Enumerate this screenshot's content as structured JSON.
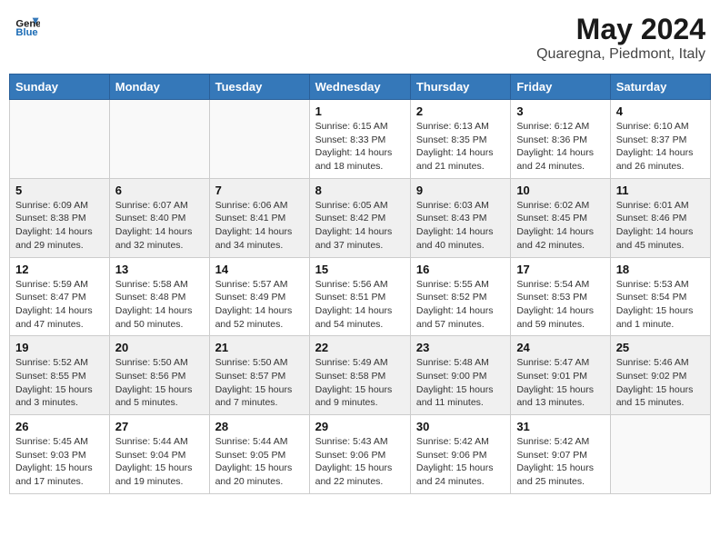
{
  "header": {
    "logo_text_part1": "General",
    "logo_text_part2": "Blue",
    "title": "May 2024",
    "subtitle": "Quaregna, Piedmont, Italy"
  },
  "weekdays": [
    "Sunday",
    "Monday",
    "Tuesday",
    "Wednesday",
    "Thursday",
    "Friday",
    "Saturday"
  ],
  "weeks": [
    [
      {
        "day": "",
        "info": ""
      },
      {
        "day": "",
        "info": ""
      },
      {
        "day": "",
        "info": ""
      },
      {
        "day": "1",
        "info": "Sunrise: 6:15 AM\nSunset: 8:33 PM\nDaylight: 14 hours\nand 18 minutes."
      },
      {
        "day": "2",
        "info": "Sunrise: 6:13 AM\nSunset: 8:35 PM\nDaylight: 14 hours\nand 21 minutes."
      },
      {
        "day": "3",
        "info": "Sunrise: 6:12 AM\nSunset: 8:36 PM\nDaylight: 14 hours\nand 24 minutes."
      },
      {
        "day": "4",
        "info": "Sunrise: 6:10 AM\nSunset: 8:37 PM\nDaylight: 14 hours\nand 26 minutes."
      }
    ],
    [
      {
        "day": "5",
        "info": "Sunrise: 6:09 AM\nSunset: 8:38 PM\nDaylight: 14 hours\nand 29 minutes."
      },
      {
        "day": "6",
        "info": "Sunrise: 6:07 AM\nSunset: 8:40 PM\nDaylight: 14 hours\nand 32 minutes."
      },
      {
        "day": "7",
        "info": "Sunrise: 6:06 AM\nSunset: 8:41 PM\nDaylight: 14 hours\nand 34 minutes."
      },
      {
        "day": "8",
        "info": "Sunrise: 6:05 AM\nSunset: 8:42 PM\nDaylight: 14 hours\nand 37 minutes."
      },
      {
        "day": "9",
        "info": "Sunrise: 6:03 AM\nSunset: 8:43 PM\nDaylight: 14 hours\nand 40 minutes."
      },
      {
        "day": "10",
        "info": "Sunrise: 6:02 AM\nSunset: 8:45 PM\nDaylight: 14 hours\nand 42 minutes."
      },
      {
        "day": "11",
        "info": "Sunrise: 6:01 AM\nSunset: 8:46 PM\nDaylight: 14 hours\nand 45 minutes."
      }
    ],
    [
      {
        "day": "12",
        "info": "Sunrise: 5:59 AM\nSunset: 8:47 PM\nDaylight: 14 hours\nand 47 minutes."
      },
      {
        "day": "13",
        "info": "Sunrise: 5:58 AM\nSunset: 8:48 PM\nDaylight: 14 hours\nand 50 minutes."
      },
      {
        "day": "14",
        "info": "Sunrise: 5:57 AM\nSunset: 8:49 PM\nDaylight: 14 hours\nand 52 minutes."
      },
      {
        "day": "15",
        "info": "Sunrise: 5:56 AM\nSunset: 8:51 PM\nDaylight: 14 hours\nand 54 minutes."
      },
      {
        "day": "16",
        "info": "Sunrise: 5:55 AM\nSunset: 8:52 PM\nDaylight: 14 hours\nand 57 minutes."
      },
      {
        "day": "17",
        "info": "Sunrise: 5:54 AM\nSunset: 8:53 PM\nDaylight: 14 hours\nand 59 minutes."
      },
      {
        "day": "18",
        "info": "Sunrise: 5:53 AM\nSunset: 8:54 PM\nDaylight: 15 hours\nand 1 minute."
      }
    ],
    [
      {
        "day": "19",
        "info": "Sunrise: 5:52 AM\nSunset: 8:55 PM\nDaylight: 15 hours\nand 3 minutes."
      },
      {
        "day": "20",
        "info": "Sunrise: 5:50 AM\nSunset: 8:56 PM\nDaylight: 15 hours\nand 5 minutes."
      },
      {
        "day": "21",
        "info": "Sunrise: 5:50 AM\nSunset: 8:57 PM\nDaylight: 15 hours\nand 7 minutes."
      },
      {
        "day": "22",
        "info": "Sunrise: 5:49 AM\nSunset: 8:58 PM\nDaylight: 15 hours\nand 9 minutes."
      },
      {
        "day": "23",
        "info": "Sunrise: 5:48 AM\nSunset: 9:00 PM\nDaylight: 15 hours\nand 11 minutes."
      },
      {
        "day": "24",
        "info": "Sunrise: 5:47 AM\nSunset: 9:01 PM\nDaylight: 15 hours\nand 13 minutes."
      },
      {
        "day": "25",
        "info": "Sunrise: 5:46 AM\nSunset: 9:02 PM\nDaylight: 15 hours\nand 15 minutes."
      }
    ],
    [
      {
        "day": "26",
        "info": "Sunrise: 5:45 AM\nSunset: 9:03 PM\nDaylight: 15 hours\nand 17 minutes."
      },
      {
        "day": "27",
        "info": "Sunrise: 5:44 AM\nSunset: 9:04 PM\nDaylight: 15 hours\nand 19 minutes."
      },
      {
        "day": "28",
        "info": "Sunrise: 5:44 AM\nSunset: 9:05 PM\nDaylight: 15 hours\nand 20 minutes."
      },
      {
        "day": "29",
        "info": "Sunrise: 5:43 AM\nSunset: 9:06 PM\nDaylight: 15 hours\nand 22 minutes."
      },
      {
        "day": "30",
        "info": "Sunrise: 5:42 AM\nSunset: 9:06 PM\nDaylight: 15 hours\nand 24 minutes."
      },
      {
        "day": "31",
        "info": "Sunrise: 5:42 AM\nSunset: 9:07 PM\nDaylight: 15 hours\nand 25 minutes."
      },
      {
        "day": "",
        "info": ""
      }
    ]
  ]
}
